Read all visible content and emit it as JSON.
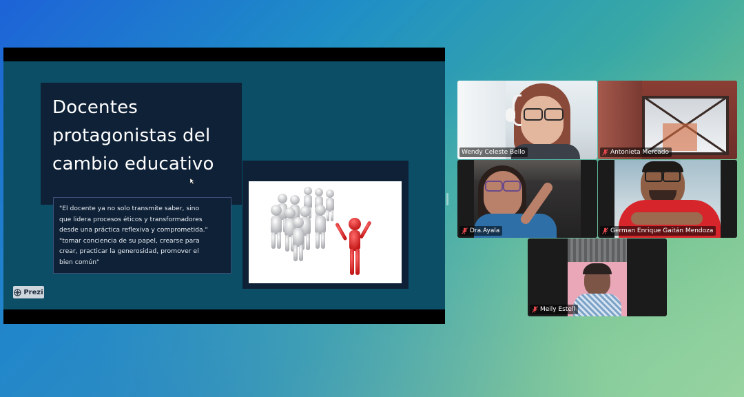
{
  "presentation": {
    "title_lines": [
      "Docentes",
      "protagonistas del",
      "cambio educativo"
    ],
    "quote_lines": [
      "\"El docente ya no solo transmite saber, sino",
      "que lidera procesos éticos y transformadores",
      "desde una práctica reflexiva y comprometida.\"",
      "\"tomar conciencia de su papel, crearse para",
      "crear, practicar la generosidad, promover el",
      "bien común\""
    ],
    "badge_label": "Prezi"
  },
  "participants": [
    {
      "name": "Wendy Celeste Bello",
      "muted": false,
      "speaking": true
    },
    {
      "name": "Antonieta Mercado",
      "muted": true,
      "speaking": false
    },
    {
      "name": "Dra.Ayala",
      "muted": true,
      "speaking": false
    },
    {
      "name": "German Enrique Gaitán Mendoza",
      "muted": true,
      "speaking": false
    },
    {
      "name": "Meily Estell",
      "muted": true,
      "speaking": false
    }
  ],
  "colors": {
    "active_speaker_border": "#35d07f",
    "muted_icon": "#e5484d",
    "slide_background": "#0b4e66",
    "slide_panel": "#0e2137"
  }
}
